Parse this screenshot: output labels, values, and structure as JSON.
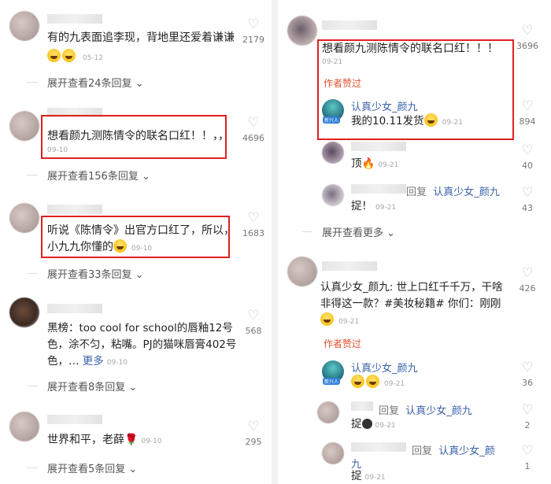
{
  "left": {
    "comments": [
      {
        "text": "有的九表面追李现，背地里还爱着谦谦",
        "time": "05-12",
        "likes": "2179",
        "replies": "展开查看24条回复"
      },
      {
        "text": "想看颜九测陈情令的联名口红！！，，",
        "time": "09-10",
        "likes": "4696",
        "replies": "展开查看156条回复"
      },
      {
        "text_line1": "听说《陈情令》出官方口红了，所以，",
        "text_line2": "小九九你懂的",
        "time": "09-10",
        "likes": "1683",
        "replies": "展开查看33条回复"
      },
      {
        "text_line1": "黑榜：too cool for school的唇釉12号",
        "text_line2": "色，涂不匀，粘嘴。PJ的猫咪唇膏402号",
        "text_line3": "色，…",
        "more": "更多",
        "time": "09-10",
        "likes": "568",
        "replies": "展开查看8条回复"
      },
      {
        "text": "世界和平，老薛",
        "time": "09-10",
        "likes": "295",
        "replies": "展开查看5条回复"
      }
    ]
  },
  "right": {
    "top_comment": {
      "text": "想看颜九测陈情令的联名口红！！！",
      "time": "09-21",
      "likes": "3696",
      "author_liked": "作者赞过"
    },
    "sub1": {
      "name": "认真少女_颜九",
      "text": "我的10.11发货",
      "time": "09-21",
      "likes": "894"
    },
    "sub2": {
      "text": "顶",
      "time": "09-21",
      "likes": "40"
    },
    "sub3": {
      "reply": "回复",
      "name": "认真少女_颜九",
      "text": "捉！",
      "time": "09-21",
      "likes": "43"
    },
    "expand_more": "展开查看更多",
    "second_comment": {
      "text_line1": "认真少女_颜九: 世上口红千千万，干啥",
      "text_line2": "非得这一款？#美妆秘籍# 你们：刚刚",
      "time": "09-21",
      "likes": "426",
      "author_liked": "作者赞过"
    },
    "sub4": {
      "name": "认真少女_颜九",
      "time": "09-21",
      "likes": "36"
    },
    "sub5": {
      "reply": "回复",
      "name": "认真少女_颜九",
      "text": "捉",
      "time": "09-21",
      "likes": "2"
    },
    "sub6": {
      "reply": "回复",
      "name_line1": "认真少女_颜",
      "name_line2": "九",
      "text": "捉",
      "time": "09-21",
      "likes": "1"
    }
  }
}
